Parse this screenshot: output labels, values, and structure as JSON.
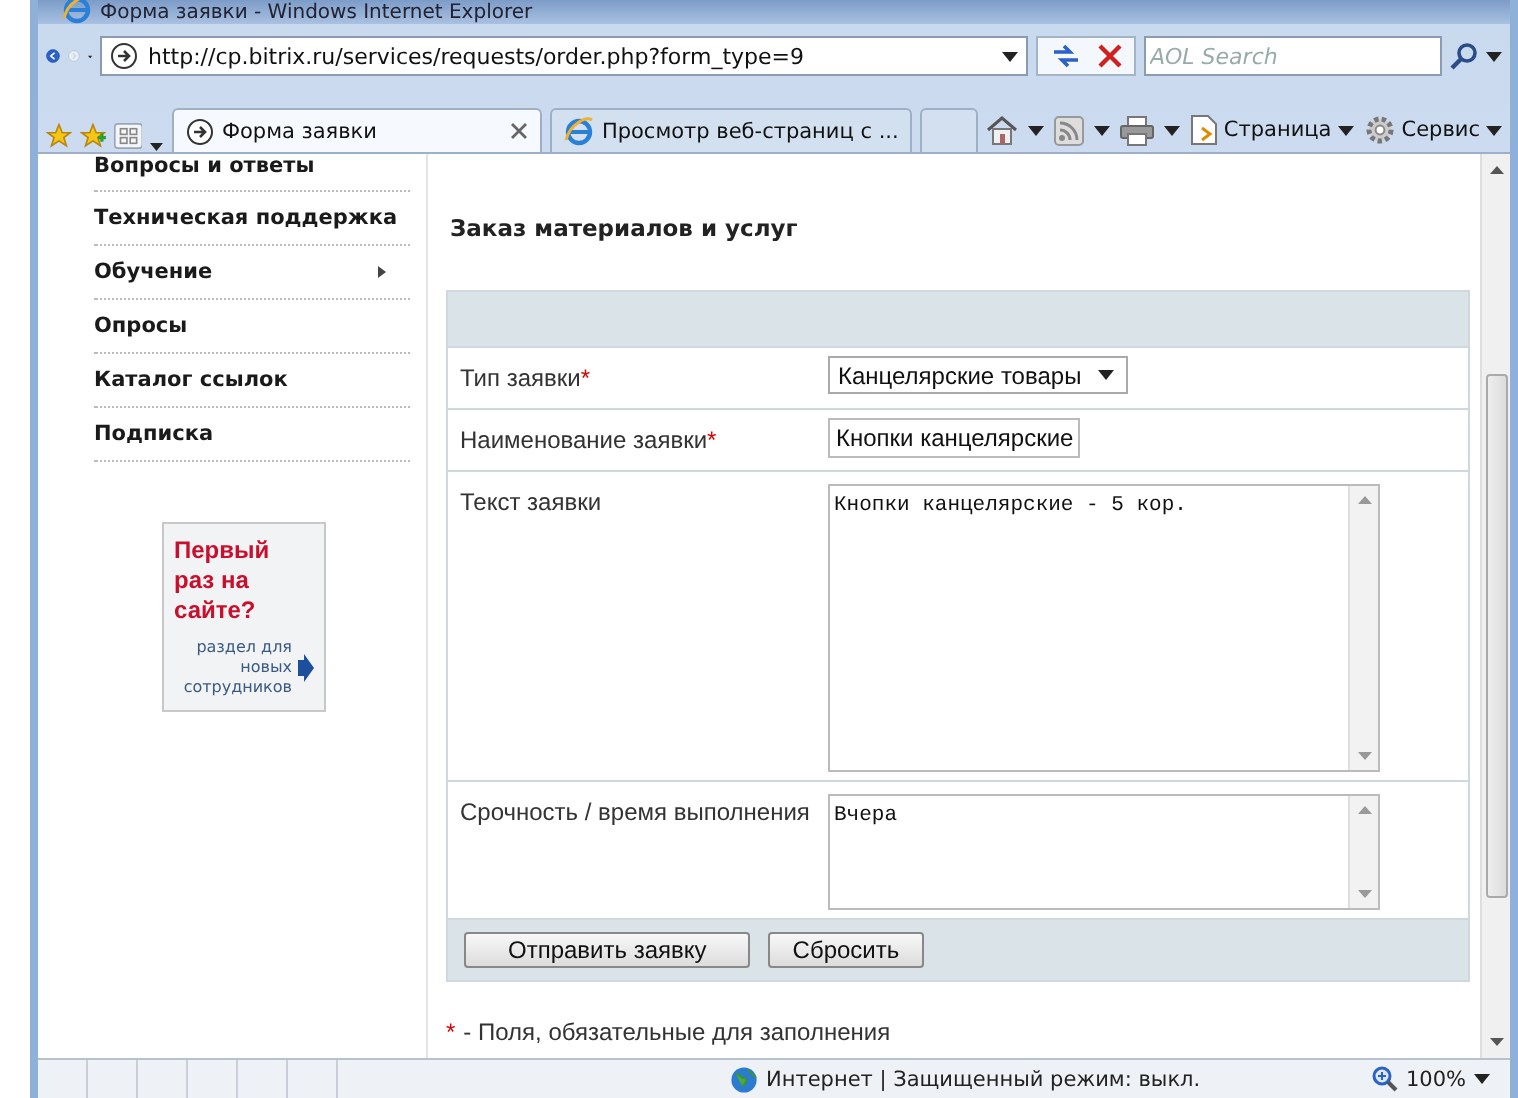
{
  "window": {
    "title": "Форма заявки - Windows Internet Explorer"
  },
  "address_bar": {
    "url": "http://cp.bitrix.ru/services/requests/order.php?form_type=9"
  },
  "search": {
    "placeholder": "AOL Search"
  },
  "tabs": [
    {
      "label": "Форма заявки",
      "selected": true
    },
    {
      "label": "Просмотр веб-страниц с ...",
      "selected": false
    }
  ],
  "command_bar": {
    "page_menu": "Страница",
    "tools_menu": "Сервис"
  },
  "sidebar": {
    "items": [
      {
        "label": "Вопросы и ответы",
        "has_submenu": false
      },
      {
        "label": "Техническая поддержка",
        "has_submenu": false
      },
      {
        "label": "Обучение",
        "has_submenu": true
      },
      {
        "label": "Опросы",
        "has_submenu": false
      },
      {
        "label": "Каталог ссылок",
        "has_submenu": false
      },
      {
        "label": "Подписка",
        "has_submenu": false
      }
    ],
    "promo": {
      "title": "Первый раз на сайте?",
      "text": "раздел для новых сотрудников"
    }
  },
  "form": {
    "heading": "Заказ материалов и услуг",
    "required_mark": "*",
    "fields": [
      {
        "kind": "select",
        "label": "Тип заявки",
        "required": true,
        "value": "Канцелярские товары"
      },
      {
        "kind": "text",
        "label": "Наименование заявки",
        "required": true,
        "value": "Кнопки канцелярские"
      },
      {
        "kind": "textarea",
        "label": "Текст заявки",
        "required": false,
        "value": "Кнопки канцелярские - 5 кор."
      },
      {
        "kind": "textarea",
        "label": "Срочность / время выполнения",
        "required": false,
        "value": "Вчера"
      }
    ],
    "buttons": [
      "Отправить заявку",
      "Сбросить"
    ],
    "footnote": "- Поля, обязательные для заполнения"
  },
  "status_bar": {
    "zone": "Интернет | Защищенный режим: выкл.",
    "zoom": "100%"
  }
}
